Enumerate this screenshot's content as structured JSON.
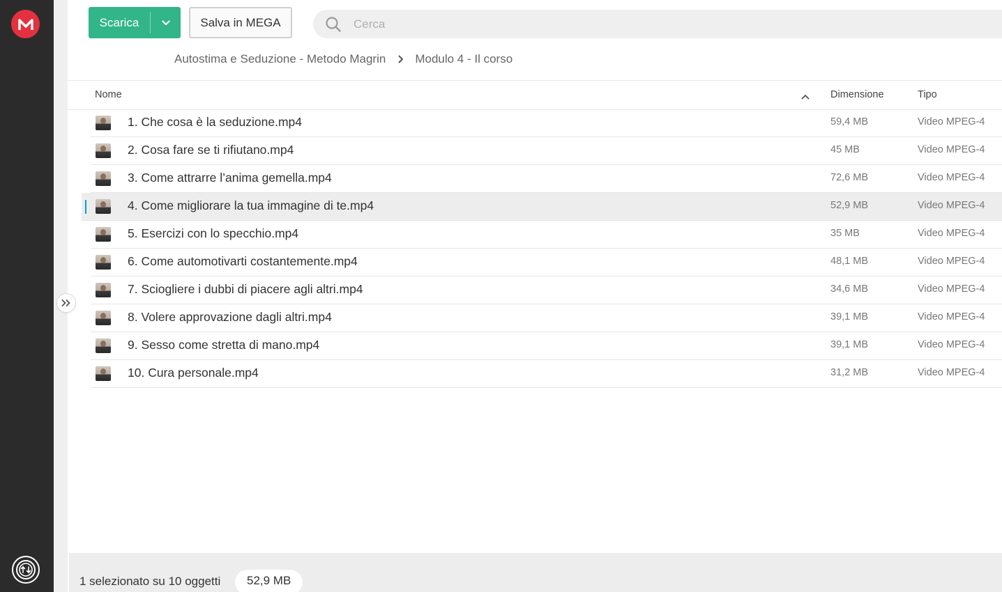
{
  "toolbar": {
    "download_label": "Scarica",
    "save_label": "Salva in MEGA",
    "search_placeholder": "Cerca"
  },
  "breadcrumb": [
    "Autostima e Seduzione - Metodo Magrin",
    "Modulo 4 - Il corso"
  ],
  "table": {
    "headers": {
      "name": "Nome",
      "size": "Dimensione",
      "type": "Tipo"
    },
    "rows": [
      {
        "name": "1. Che cosa è la seduzione.mp4",
        "size": "59,4 MB",
        "type": "Video MPEG-4"
      },
      {
        "name": "2. Cosa fare se ti rifiutano.mp4",
        "size": "45 MB",
        "type": "Video MPEG-4"
      },
      {
        "name": "3. Come attrarre l’anima gemella.mp4",
        "size": "72,6 MB",
        "type": "Video MPEG-4"
      },
      {
        "name": "4. Come migliorare la tua immagine di te.mp4",
        "size": "52,9 MB",
        "type": "Video MPEG-4",
        "selected": true
      },
      {
        "name": "5. Esercizi con lo specchio.mp4",
        "size": "35 MB",
        "type": "Video MPEG-4"
      },
      {
        "name": "6. Come automotivarti costantemente.mp4",
        "size": "48,1 MB",
        "type": "Video MPEG-4"
      },
      {
        "name": "7. Sciogliere i dubbi di piacere agli altri.mp4",
        "size": "34,6 MB",
        "type": "Video MPEG-4"
      },
      {
        "name": "8. Volere approvazione dagli altri.mp4",
        "size": "39,1 MB",
        "type": "Video MPEG-4"
      },
      {
        "name": "9. Sesso come stretta di mano.mp4",
        "size": "39,1 MB",
        "type": "Video MPEG-4"
      },
      {
        "name": "10. Cura personale.mp4",
        "size": "31,2 MB",
        "type": "Video MPEG-4"
      }
    ]
  },
  "status": {
    "selection_text": "1 selezionato su 10 oggetti",
    "selection_size": "52,9 MB"
  },
  "colors": {
    "mega_red": "#e4313f",
    "download_green": "#31b589",
    "selection_accent": "#00a0e0",
    "rail_dark": "#2b2b2b"
  },
  "icons": {
    "logo": "mega-logo-icon",
    "transfer": "transfer-manager-icon",
    "expand": "double-chevron-right-icon",
    "search": "search-icon",
    "dropdown": "chevron-down-icon",
    "breadcrumb_sep": "chevron-right-icon",
    "sort": "sort-ascending-icon",
    "file": "video-thumbnail-icon"
  }
}
